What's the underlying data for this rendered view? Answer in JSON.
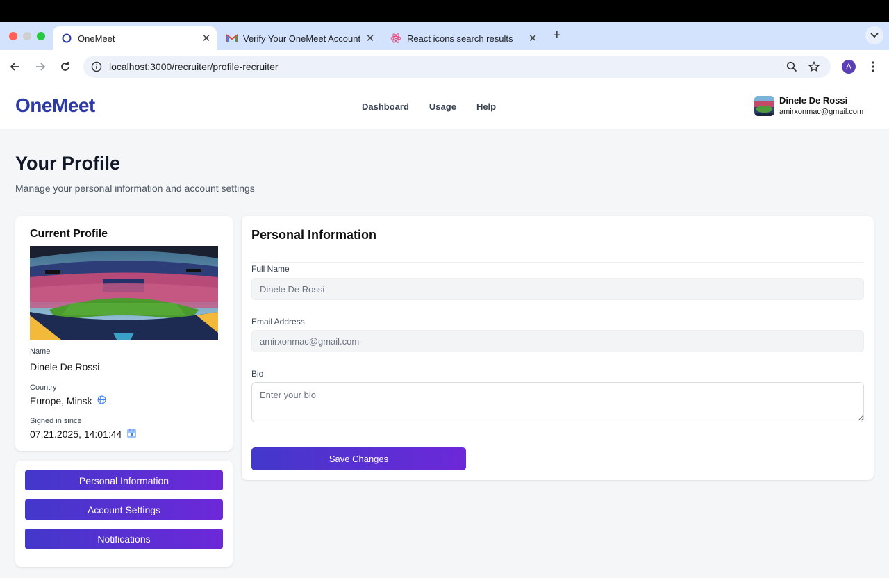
{
  "browser": {
    "tabs": [
      {
        "title": "OneMeet",
        "active": true
      },
      {
        "title": "Verify Your OneMeet Account",
        "active": false
      },
      {
        "title": "React icons search results",
        "active": false
      }
    ],
    "url": "localhost:3000/recruiter/profile-recruiter",
    "profile_initial": "A"
  },
  "header": {
    "logo": "OneMeet",
    "nav": [
      "Dashboard",
      "Usage",
      "Help"
    ],
    "user_name": "Dinele  De Rossi",
    "user_email": "amirxonmac@gmail.com"
  },
  "page": {
    "title": "Your Profile",
    "subtitle": "Manage your personal information and account settings"
  },
  "current_profile": {
    "title": "Current Profile",
    "name_label": "Name",
    "name_value": "Dinele  De Rossi",
    "country_label": "Country",
    "country_value": "Europe, Minsk",
    "signed_label": "Signed in since",
    "signed_value": "07.21.2025, 14:01:44"
  },
  "menu": [
    "Personal Information",
    "Account Settings",
    "Notifications"
  ],
  "form": {
    "title": "Personal Information",
    "full_name_label": "Full Name",
    "full_name_value": "Dinele De Rossi",
    "email_label": "Email Address",
    "email_value": "amirxonmac@gmail.com",
    "bio_label": "Bio",
    "bio_placeholder": "Enter your bio",
    "save_label": "Save Changes"
  },
  "colors": {
    "brand": "#2d3aa8",
    "button_gradient_start": "#4338ca",
    "button_gradient_end": "#6d28d9"
  }
}
